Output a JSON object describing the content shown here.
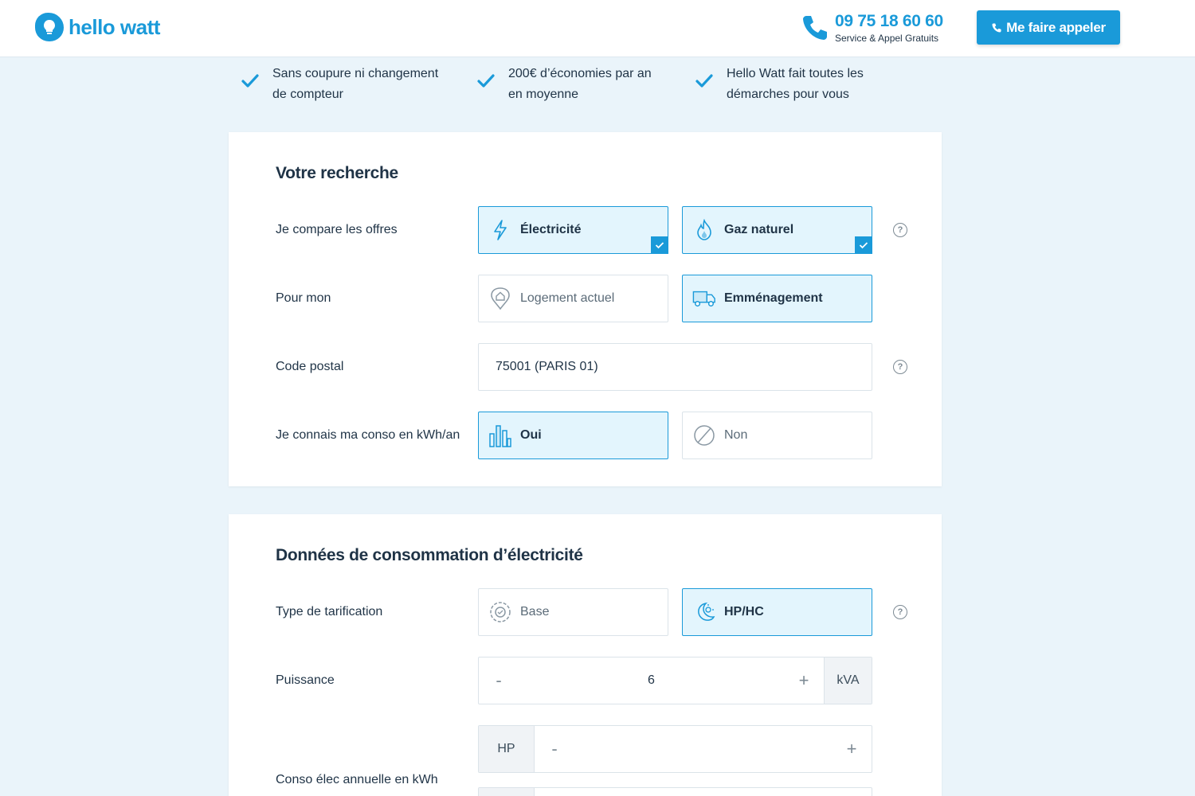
{
  "header": {
    "logo_text": "hello watt",
    "phone_number": "09 75 18 60 60",
    "phone_sub": "Service & Appel Gratuits",
    "call_button": "Me faire appeler"
  },
  "benefits": [
    {
      "line1": "Sans coupure ni changement",
      "line2": "de compteur"
    },
    {
      "line1": "200€ d’économies par an",
      "line2": "en moyenne"
    },
    {
      "line1": "Hello Watt fait toutes les",
      "line2": "démarches pour vous"
    }
  ],
  "search": {
    "title": "Votre recherche",
    "compare_label": "Je compare les offres",
    "compare_options": [
      {
        "label": "Électricité",
        "selected": true,
        "icon": "lightning-icon"
      },
      {
        "label": "Gaz naturel",
        "selected": true,
        "icon": "flame-icon"
      }
    ],
    "pour_label": "Pour mon",
    "pour_options": [
      {
        "label": "Logement actuel",
        "selected": false,
        "icon": "home-pin-icon"
      },
      {
        "label": "Emménagement",
        "selected": true,
        "icon": "truck-icon"
      }
    ],
    "postal_label": "Code postal",
    "postal_value": "75001 (PARIS 01)",
    "conso_label": "Je connais ma conso en kWh/an",
    "conso_options": [
      {
        "label": "Oui",
        "selected": true,
        "icon": "bar-chart-icon"
      },
      {
        "label": "Non",
        "selected": false,
        "icon": "slash-circle-icon"
      }
    ]
  },
  "electricity": {
    "title": "Données de consommation d’électricité",
    "tarif_label": "Type de tarification",
    "tarif_options": [
      {
        "label": "Base",
        "selected": false,
        "icon": "meter-icon"
      },
      {
        "label": "HP/HC",
        "selected": true,
        "icon": "moon-sun-icon"
      }
    ],
    "puissance_label": "Puissance",
    "puissance_value": "6",
    "puissance_unit": "kVA",
    "annual_label": "Conso élec annuelle en kWh",
    "hp_prefix": "HP",
    "stepper_minus": "-",
    "stepper_plus": "+"
  },
  "help_glyph": "?",
  "colors": {
    "accent": "#1a9ad9",
    "background": "#eaf4fa",
    "selected_fill": "#e3f5fd",
    "text": "#1f3346"
  }
}
